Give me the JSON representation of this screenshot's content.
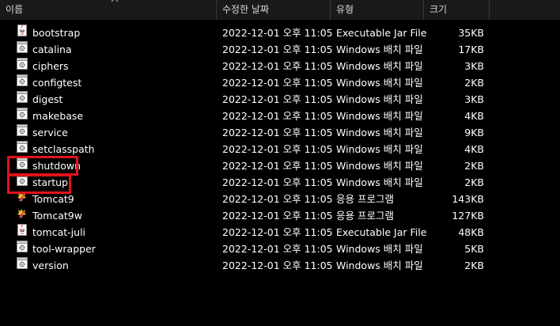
{
  "columns": {
    "name": "이름",
    "date": "수정한 날짜",
    "type": "유형",
    "size": "크기"
  },
  "files": [
    {
      "name": "bootstrap",
      "date": "2022-12-01 오후 11:05",
      "type": "Executable Jar File",
      "size": "35KB",
      "icon": "jar-file-icon"
    },
    {
      "name": "catalina",
      "date": "2022-12-01 오후 11:05",
      "type": "Windows 배치 파일",
      "size": "17KB",
      "icon": "batch-file-icon"
    },
    {
      "name": "ciphers",
      "date": "2022-12-01 오후 11:05",
      "type": "Windows 배치 파일",
      "size": "3KB",
      "icon": "batch-file-icon"
    },
    {
      "name": "configtest",
      "date": "2022-12-01 오후 11:05",
      "type": "Windows 배치 파일",
      "size": "2KB",
      "icon": "batch-file-icon"
    },
    {
      "name": "digest",
      "date": "2022-12-01 오후 11:05",
      "type": "Windows 배치 파일",
      "size": "3KB",
      "icon": "batch-file-icon"
    },
    {
      "name": "makebase",
      "date": "2022-12-01 오후 11:05",
      "type": "Windows 배치 파일",
      "size": "4KB",
      "icon": "batch-file-icon"
    },
    {
      "name": "service",
      "date": "2022-12-01 오후 11:05",
      "type": "Windows 배치 파일",
      "size": "9KB",
      "icon": "batch-file-icon"
    },
    {
      "name": "setclasspath",
      "date": "2022-12-01 오후 11:05",
      "type": "Windows 배치 파일",
      "size": "4KB",
      "icon": "batch-file-icon"
    },
    {
      "name": "shutdown",
      "date": "2022-12-01 오후 11:05",
      "type": "Windows 배치 파일",
      "size": "2KB",
      "icon": "batch-file-icon",
      "highlighted": true
    },
    {
      "name": "startup",
      "date": "2022-12-01 오후 11:05",
      "type": "Windows 배치 파일",
      "size": "2KB",
      "icon": "batch-file-icon",
      "highlighted": true
    },
    {
      "name": "Tomcat9",
      "date": "2022-12-01 오후 11:05",
      "type": "응용 프로그램",
      "size": "143KB",
      "icon": "tomcat-app-icon"
    },
    {
      "name": "Tomcat9w",
      "date": "2022-12-01 오후 11:05",
      "type": "응용 프로그램",
      "size": "127KB",
      "icon": "tomcat-app-icon"
    },
    {
      "name": "tomcat-juli",
      "date": "2022-12-01 오후 11:05",
      "type": "Executable Jar File",
      "size": "48KB",
      "icon": "jar-file-icon"
    },
    {
      "name": "tool-wrapper",
      "date": "2022-12-01 오후 11:05",
      "type": "Windows 배치 파일",
      "size": "5KB",
      "icon": "batch-file-icon"
    },
    {
      "name": "version",
      "date": "2022-12-01 오후 11:05",
      "type": "Windows 배치 파일",
      "size": "2KB",
      "icon": "batch-file-icon"
    }
  ],
  "colors": {
    "background": "#000000",
    "header_background": "#191919",
    "highlight_border": "#e1121b",
    "text": "#ffffff"
  }
}
